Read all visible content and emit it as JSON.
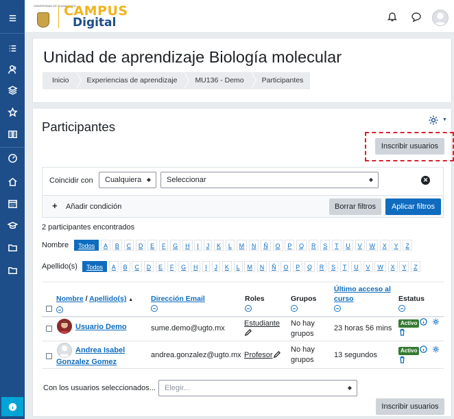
{
  "header": {
    "logo_small_text": "UNIVERSIDAD DE GUANAJUATO",
    "logo_line1": "CAMPUS",
    "logo_line2": "Digital"
  },
  "course": {
    "title": "Unidad de aprendizaje Biología molecular"
  },
  "breadcrumb": [
    "Inicio",
    "Experiencias de aprendizaje",
    "MU136 - Demo",
    "Participantes"
  ],
  "page": {
    "title": "Participantes",
    "enrol_button": "Inscribir usuarios"
  },
  "filter": {
    "match_label": "Coincidir con",
    "match_value": "Cualquiera",
    "select_placeholder": "Seleccionar",
    "add_condition": "Añadir condición",
    "clear_button": "Borrar filtros",
    "apply_button": "Aplicar filtros"
  },
  "count_text": "2 participantes encontrados",
  "initials": {
    "first_label": "Nombre",
    "last_label": "Apellido(s)",
    "all": "Todos",
    "letters": [
      "A",
      "B",
      "C",
      "D",
      "E",
      "F",
      "G",
      "H",
      "I",
      "J",
      "K",
      "L",
      "M",
      "N",
      "Ñ",
      "O",
      "P",
      "Q",
      "R",
      "S",
      "T",
      "U",
      "V",
      "W",
      "X",
      "Y",
      "Z"
    ]
  },
  "table": {
    "col_name_first": "Nombre",
    "col_name_sep": " / ",
    "col_name_last": "Apellido(s)",
    "col_email": "Dirección Email",
    "col_roles": "Roles",
    "col_groups": "Grupos",
    "col_access_l1": "Último acceso al",
    "col_access_l2": "curso",
    "col_status": "Estatus",
    "rows": [
      {
        "name": "Usuario Demo",
        "email": "sume.demo@ugto.mx",
        "role": "Estudiante",
        "groups_l1": "No hay",
        "groups_l2": "grupos",
        "access": "23 horas 56 mins",
        "status": "Activo"
      },
      {
        "name_l1": "Andrea Isabel",
        "name_l2": "Gonzalez Gomez",
        "email": "andrea.gonzalez@ugto.mx",
        "role": "Profesor",
        "groups_l1": "No hay",
        "groups_l2": "grupos",
        "access": "13 segundos",
        "status": "Activo"
      }
    ]
  },
  "bulk": {
    "label": "Con los usuarios seleccionados...",
    "placeholder": "Elegir..."
  },
  "colors": {
    "rail": "#1d4e89",
    "primary": "#0f6cbf",
    "brand_gold": "#f0b41c",
    "badge": "#357a32",
    "highlight": "#d8202e"
  },
  "icons": {
    "rail": [
      "menu-icon",
      "list-icon",
      "users-icon",
      "layers-icon",
      "star-icon",
      "book-icon",
      "gauge-icon",
      "home-icon",
      "calendar-icon",
      "graduation-cap-icon",
      "folder-icon",
      "folder-icon",
      "info-icon"
    ],
    "topbar": [
      "bell-icon",
      "chat-icon",
      "user-avatar"
    ]
  }
}
